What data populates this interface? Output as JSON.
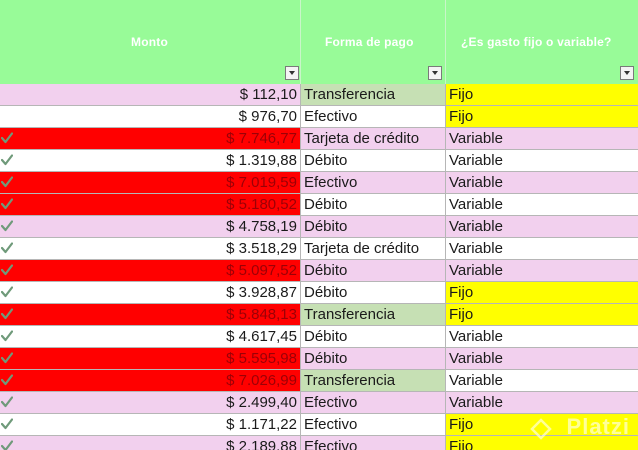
{
  "colors": {
    "header_bg": "#98fb98",
    "row_pink": "#f2d0ee",
    "row_white": "#ffffff",
    "red_fill": "#ff0000",
    "green_fill": "#c6e0b4",
    "yellow_fill": "#ffff00",
    "red_text": "#9c0006"
  },
  "header": {
    "columns": [
      {
        "label": "Monto"
      },
      {
        "label": "Forma de pago"
      },
      {
        "label": "¿Es gasto fijo o variable?"
      }
    ]
  },
  "watermark": {
    "text": "Platzi"
  },
  "rows": [
    {
      "check": false,
      "monto": "$ 112,10",
      "forma": "Transferencia",
      "fijo": "Fijo",
      "bg": "pink",
      "monto_red": false,
      "forma_green": true,
      "fijo_yellow": true
    },
    {
      "check": false,
      "monto": "$ 976,70",
      "forma": "Efectivo",
      "fijo": "Fijo",
      "bg": "white",
      "monto_red": false,
      "forma_green": false,
      "fijo_yellow": true
    },
    {
      "check": true,
      "monto": "$ 7.746,77",
      "forma": "Tarjeta de crédito",
      "fijo": "Variable",
      "bg": "pink",
      "monto_red": true,
      "forma_green": false,
      "fijo_yellow": false
    },
    {
      "check": true,
      "monto": "$ 1.319,88",
      "forma": "Débito",
      "fijo": "Variable",
      "bg": "white",
      "monto_red": false,
      "forma_green": false,
      "fijo_yellow": false
    },
    {
      "check": true,
      "monto": "$ 7.019,59",
      "forma": "Efectivo",
      "fijo": "Variable",
      "bg": "pink",
      "monto_red": true,
      "forma_green": false,
      "fijo_yellow": false
    },
    {
      "check": true,
      "monto": "$ 5.180,52",
      "forma": "Débito",
      "fijo": "Variable",
      "bg": "white",
      "monto_red": true,
      "forma_green": false,
      "fijo_yellow": false
    },
    {
      "check": true,
      "monto": "$ 4.758,19",
      "forma": "Débito",
      "fijo": "Variable",
      "bg": "pink",
      "monto_red": false,
      "forma_green": false,
      "fijo_yellow": false
    },
    {
      "check": true,
      "monto": "$ 3.518,29",
      "forma": "Tarjeta de crédito",
      "fijo": "Variable",
      "bg": "white",
      "monto_red": false,
      "forma_green": false,
      "fijo_yellow": false
    },
    {
      "check": true,
      "monto": "$ 5.097,52",
      "forma": "Débito",
      "fijo": "Variable",
      "bg": "pink",
      "monto_red": true,
      "forma_green": false,
      "fijo_yellow": false
    },
    {
      "check": true,
      "monto": "$ 3.928,87",
      "forma": "Débito",
      "fijo": "Fijo",
      "bg": "white",
      "monto_red": false,
      "forma_green": false,
      "fijo_yellow": true
    },
    {
      "check": true,
      "monto": "$ 5.848,13",
      "forma": "Transferencia",
      "fijo": "Fijo",
      "bg": "pink",
      "monto_red": true,
      "forma_green": true,
      "fijo_yellow": true
    },
    {
      "check": true,
      "monto": "$ 4.617,45",
      "forma": "Débito",
      "fijo": "Variable",
      "bg": "white",
      "monto_red": false,
      "forma_green": false,
      "fijo_yellow": false
    },
    {
      "check": true,
      "monto": "$ 5.595,98",
      "forma": "Débito",
      "fijo": "Variable",
      "bg": "pink",
      "monto_red": true,
      "forma_green": false,
      "fijo_yellow": false
    },
    {
      "check": true,
      "monto": "$ 7.026,99",
      "forma": "Transferencia",
      "fijo": "Variable",
      "bg": "white",
      "monto_red": true,
      "forma_green": true,
      "fijo_yellow": false
    },
    {
      "check": true,
      "monto": "$ 2.499,40",
      "forma": "Efectivo",
      "fijo": "Variable",
      "bg": "pink",
      "monto_red": false,
      "forma_green": false,
      "fijo_yellow": false
    },
    {
      "check": true,
      "monto": "$ 1.171,22",
      "forma": "Efectivo",
      "fijo": "Fijo",
      "bg": "white",
      "monto_red": false,
      "forma_green": false,
      "fijo_yellow": true
    },
    {
      "check": true,
      "monto": "$ 2.189,88",
      "forma": "Efectivo",
      "fijo": "Fijo",
      "bg": "pink",
      "monto_red": false,
      "forma_green": false,
      "fijo_yellow": true
    }
  ]
}
